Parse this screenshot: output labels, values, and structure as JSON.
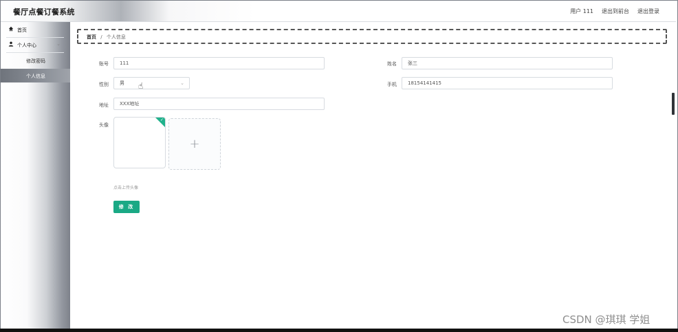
{
  "header": {
    "app_title": "餐厅点餐订餐系统",
    "user_label": "用户 111",
    "exit_front": "退出到前台",
    "logout": "退出登录"
  },
  "sidebar": {
    "home": "首页",
    "personal_center": "个人中心",
    "change_password": "修改密码",
    "personal_info": "个人信息"
  },
  "breadcrumb": {
    "home": "首页",
    "separator": "/",
    "current": "个人信息"
  },
  "form": {
    "account_label": "账号",
    "account_value": "111",
    "name_label": "姓名",
    "name_value": "张三",
    "gender_label": "性别",
    "gender_value": "男",
    "phone_label": "手机",
    "phone_value": "18154141415",
    "address_label": "地址",
    "address_value": "XXX地址",
    "avatar_label": "头像",
    "upload_hint": "点击上传头像",
    "submit_label": "修 改"
  },
  "watermark": "CSDN @琪琪 学姐",
  "colors": {
    "accent": "#1aa985",
    "corner_badge": "#21b28c"
  }
}
